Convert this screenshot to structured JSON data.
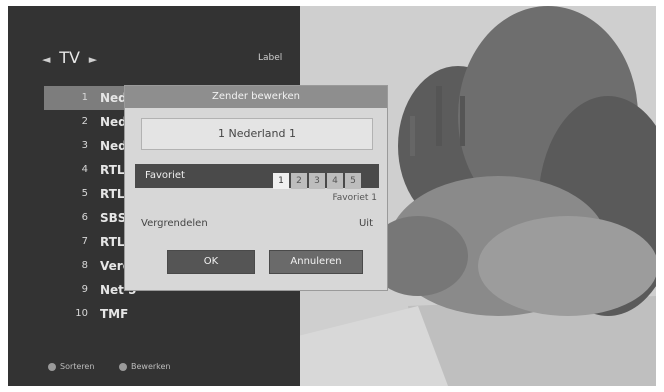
{
  "panel": {
    "nav_prev": "◄",
    "title": "TV",
    "nav_next": "►",
    "right_label": "Label"
  },
  "channels": [
    {
      "num": "1",
      "name": "Ned"
    },
    {
      "num": "2",
      "name": "Ned"
    },
    {
      "num": "3",
      "name": "Ned"
    },
    {
      "num": "4",
      "name": "RTL"
    },
    {
      "num": "5",
      "name": "RTL"
    },
    {
      "num": "6",
      "name": "SBS"
    },
    {
      "num": "7",
      "name": "RTL"
    },
    {
      "num": "8",
      "name": "Veronica / Disney"
    },
    {
      "num": "9",
      "name": "Net 5"
    },
    {
      "num": "10",
      "name": "TMF"
    }
  ],
  "footer": {
    "item1": "Sorteren",
    "item2": "Bewerken"
  },
  "dialog": {
    "title": "Zender bewerken",
    "channel_name": "1 Nederland 1",
    "favorite_label": "Favoriet",
    "favorite_boxes": [
      "1",
      "2",
      "3",
      "4",
      "5"
    ],
    "favorite_sub": "Favoriet 1",
    "lock_label": "Vergrendelen",
    "lock_value": "Uit",
    "ok_label": "OK",
    "cancel_label": "Annuleren"
  },
  "colors": {
    "panel_bg": "#333333",
    "selected_row": "#7d7d7d",
    "dialog_bg": "#d7d7d7",
    "dialog_title_bg": "#8e8e8e",
    "favorite_row_bg": "#4a4a4a"
  }
}
